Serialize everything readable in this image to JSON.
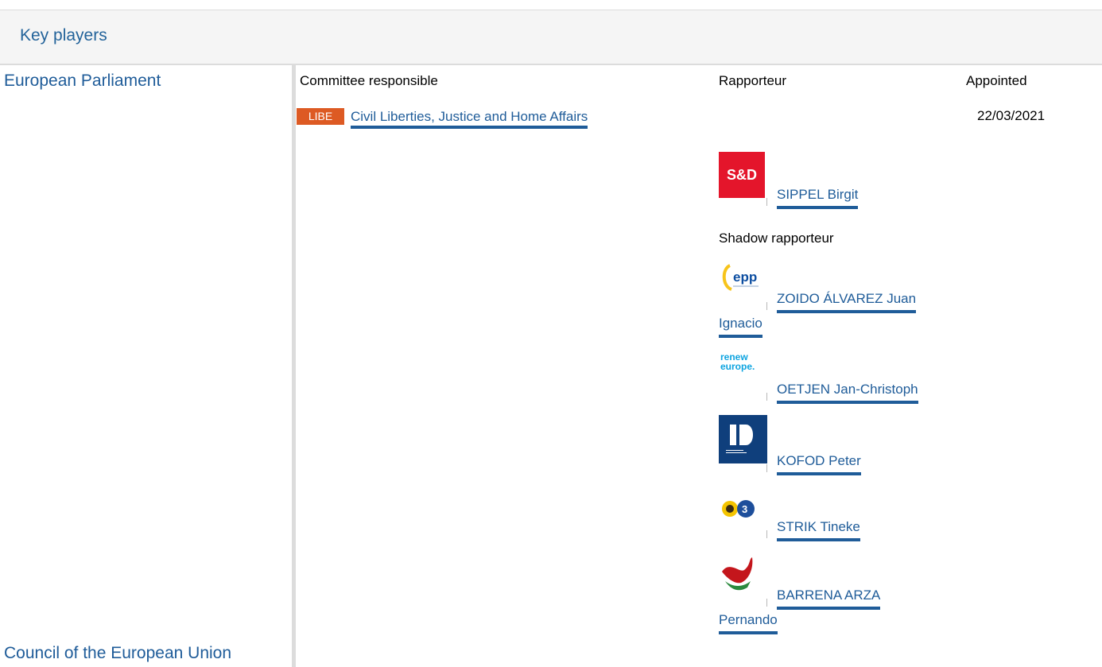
{
  "header": {
    "title": "Key players"
  },
  "institutions": {
    "parliament": "European Parliament",
    "council": "Council of the European Union"
  },
  "columns": {
    "committee": "Committee responsible",
    "rapporteur": "Rapporteur",
    "appointed": "Appointed"
  },
  "committee": {
    "code": "LIBE",
    "name": "Civil Liberties, Justice and Home Affairs",
    "appointed": "22/03/2021"
  },
  "rapporteur": {
    "name": "SIPPEL Birgit",
    "group_logo_text": "S&D"
  },
  "shadow": {
    "label": "Shadow rapporteur",
    "members": [
      {
        "line1": "ZOIDO ÁLVAREZ Juan",
        "line2": "Ignacio",
        "logo": "epp"
      },
      {
        "line1": "OETJEN Jan-Christoph",
        "line2": "",
        "logo": "renew\neurope."
      },
      {
        "line1": "KOFOD Peter",
        "line2": "",
        "logo": "id-icon"
      },
      {
        "line1": "STRIK Tineke",
        "line2": "",
        "logo": "greens-efa-icon"
      },
      {
        "line1": "BARRENA ARZA",
        "line2": "Pernando",
        "logo": "left-icon"
      }
    ]
  },
  "colors": {
    "accent": "#1f5c99",
    "badge": "#dd5a23",
    "sd_red": "#e4152b"
  }
}
